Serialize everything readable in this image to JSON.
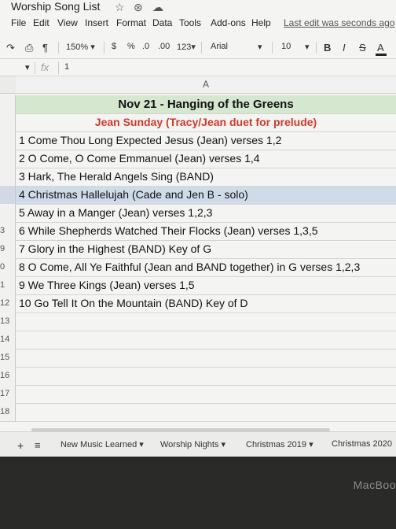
{
  "title_bar": {
    "doc_title": "Worship Song List",
    "icons": [
      "star-icon",
      "move-to-folder-icon",
      "cloud-status-icon"
    ]
  },
  "menu": {
    "items": [
      "File",
      "Edit",
      "View",
      "Insert",
      "Format",
      "Data",
      "Tools",
      "Add-ons",
      "Help"
    ],
    "last_edit": "Last edit was seconds ago"
  },
  "toolbar": {
    "zoom": "150%",
    "currency": "$",
    "percent": "%",
    "dec_decrease": ".0",
    "dec_increase": ".00",
    "more_formats": "123",
    "font": "Arial",
    "font_size": "10",
    "bold": "B",
    "italic": "I",
    "strike": "S",
    "text_color": "A"
  },
  "formula_bar": {
    "fx": "fx",
    "value": "1"
  },
  "grid": {
    "column_header": "A",
    "rows": [
      {
        "num": "",
        "text": "Nov 21 - Hanging of the Greens",
        "style": "header-green"
      },
      {
        "num": "",
        "text": "Jean Sunday (Tracy/Jean duet for prelude)",
        "style": "header-red"
      },
      {
        "num": "",
        "text": "1 Come Thou Long Expected Jesus (Jean) verses 1,2",
        "style": ""
      },
      {
        "num": "",
        "text": "2 O Come, O Come Emmanuel (Jean) verses 1,4",
        "style": ""
      },
      {
        "num": "",
        "text": "3 Hark, The Herald Angels Sing (BAND)",
        "style": ""
      },
      {
        "num": "",
        "text": "4 Christmas Hallelujah (Cade and Jen B - solo)",
        "style": "selected"
      },
      {
        "num": "",
        "text": "5 Away in a Manger (Jean) verses 1,2,3",
        "style": ""
      },
      {
        "num": "3",
        "text": "6 While Shepherds Watched Their Flocks (Jean) verses 1,3,5",
        "style": ""
      },
      {
        "num": "9",
        "text": "7 Glory in the Highest (BAND) Key of G",
        "style": ""
      },
      {
        "num": "0",
        "text": "8 O Come, All Ye Faithful (Jean and BAND together) in G verses 1,2,3",
        "style": ""
      },
      {
        "num": "1",
        "text": "9 We Three Kings (Jean) verses 1,5",
        "style": ""
      },
      {
        "num": "12",
        "text": "10 Go Tell It On the Mountain (BAND) Key of D",
        "style": ""
      },
      {
        "num": "13",
        "text": "",
        "style": ""
      },
      {
        "num": "14",
        "text": "",
        "style": ""
      },
      {
        "num": "15",
        "text": "",
        "style": ""
      },
      {
        "num": "16",
        "text": "",
        "style": ""
      },
      {
        "num": "17",
        "text": "",
        "style": ""
      },
      {
        "num": "18",
        "text": "",
        "style": ""
      }
    ]
  },
  "sheet_tabs": [
    "New Music Learned",
    "Worship Nights",
    "Christmas 2019",
    "Christmas 2020"
  ],
  "device_brand": "MacBoo"
}
